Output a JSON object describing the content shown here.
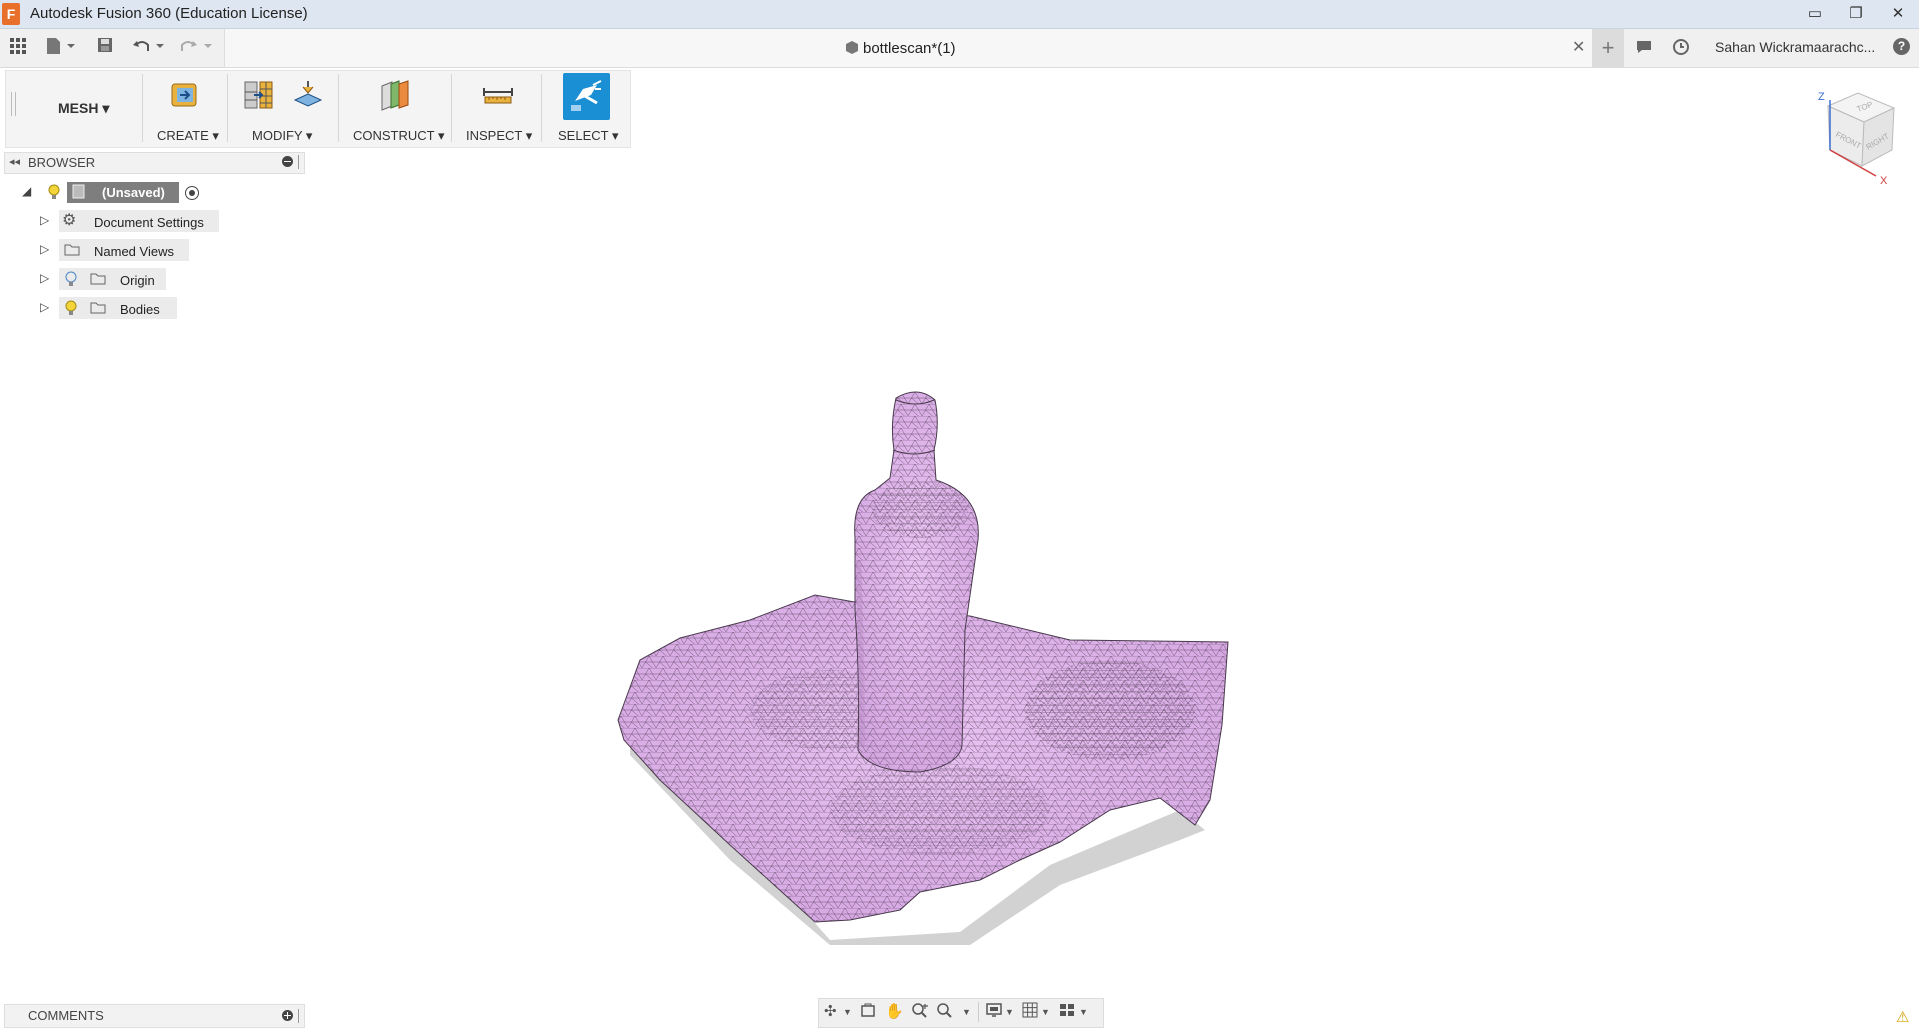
{
  "window": {
    "title": "Autodesk Fusion 360 (Education License)",
    "app_icon": "F",
    "minimize_glyph": "▭",
    "restore_glyph": "❐",
    "close_glyph": "✕"
  },
  "document_tab": {
    "label": "bottlescan*(1)",
    "close_glyph": "✕",
    "new_tab_glyph": "+"
  },
  "user": {
    "name": "Sahan Wickramaarachc...",
    "help_glyph": "?"
  },
  "toolbar": {
    "workspace": "MESH ▾",
    "create": "CREATE ▾",
    "modify": "MODIFY ▾",
    "construct": "CONSTRUCT ▾",
    "inspect": "INSPECT ▾",
    "select": "SELECT ▾"
  },
  "browser": {
    "title": "BROWSER",
    "root": "(Unsaved)",
    "items": [
      {
        "label": "Document Settings",
        "icon": "gear-icon"
      },
      {
        "label": "Named Views",
        "icon": "folder-icon"
      },
      {
        "label": "Origin",
        "icon": "folder-icon"
      },
      {
        "label": "Bodies",
        "icon": "folder-icon"
      }
    ]
  },
  "comments": {
    "title": "COMMENTS"
  },
  "viewcube": {
    "top": "TOP",
    "front": "FRONT",
    "right": "RIGHT",
    "axis_z": "Z",
    "axis_x": "X"
  },
  "colors": {
    "mesh_fill": "#e3b8ee",
    "mesh_edge": "#3a2a3e",
    "select_accent": "#1a8fd3",
    "app_orange": "#e8702a"
  }
}
